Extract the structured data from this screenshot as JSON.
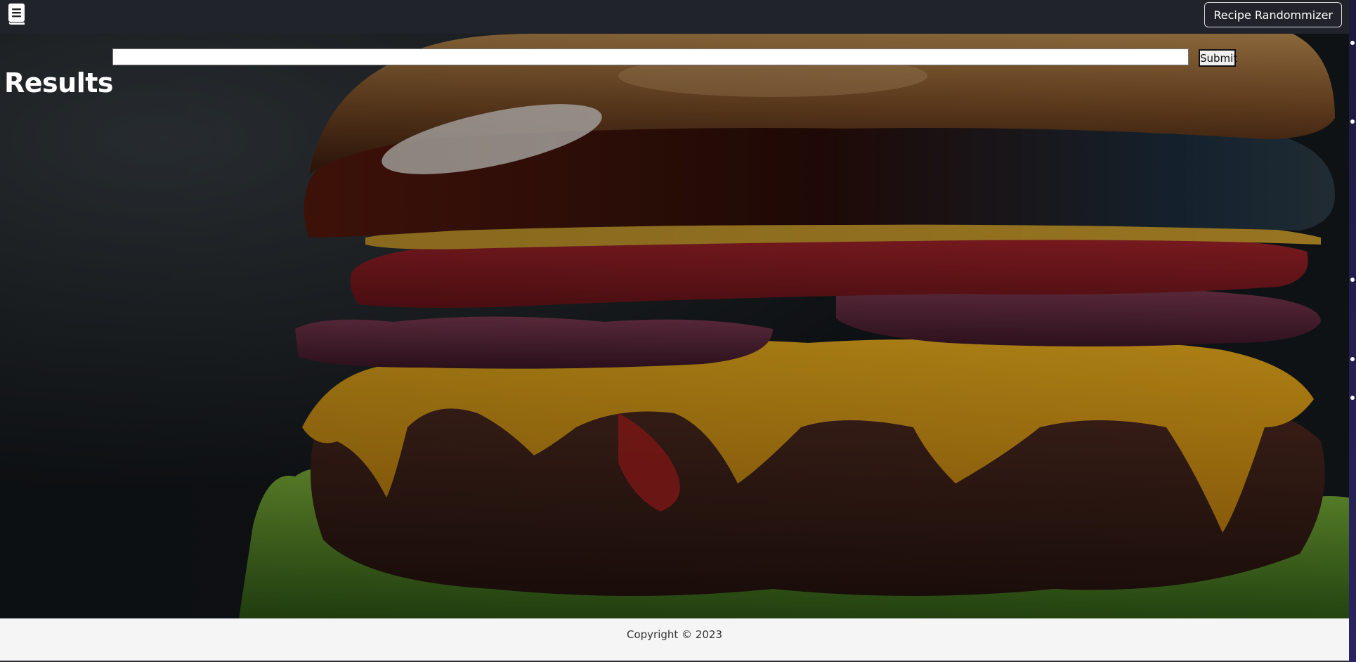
{
  "navbar": {
    "brand_icon": "book-icon",
    "button_label": "Recipe Randommizer"
  },
  "search": {
    "value": "",
    "placeholder": "",
    "submit_label": "Submit"
  },
  "results": {
    "heading": "Results"
  },
  "hero": {
    "background": "burger-photo"
  },
  "footer": {
    "copyright": "Copyright © 2023"
  },
  "colors": {
    "navbar_bg": "#202329",
    "footer_bg": "#f5f5f5",
    "heading_text": "#ffffff"
  }
}
